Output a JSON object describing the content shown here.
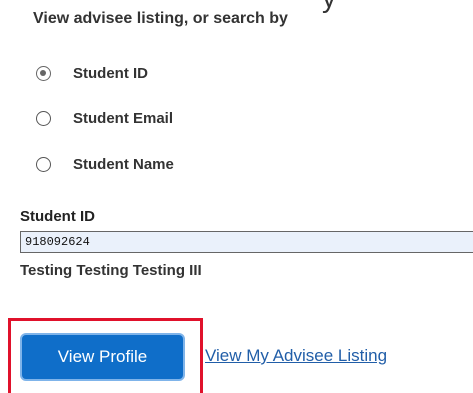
{
  "header": {
    "partial_text": "y",
    "instruction": "View advisee listing, or search by"
  },
  "search_options": [
    {
      "label": "Student ID",
      "checked": true
    },
    {
      "label": "Student Email",
      "checked": false
    },
    {
      "label": "Student Name",
      "checked": false
    }
  ],
  "student_id_field": {
    "label": "Student ID",
    "value": "918092624"
  },
  "student_result": {
    "name": "Testing Testing Testing III"
  },
  "actions": {
    "view_profile_label": "View Profile",
    "view_listing_label": "View My Advisee Listing"
  },
  "colors": {
    "primary_button": "#0f6ec9",
    "highlight_border": "#e0112b",
    "link": "#215ea8"
  }
}
